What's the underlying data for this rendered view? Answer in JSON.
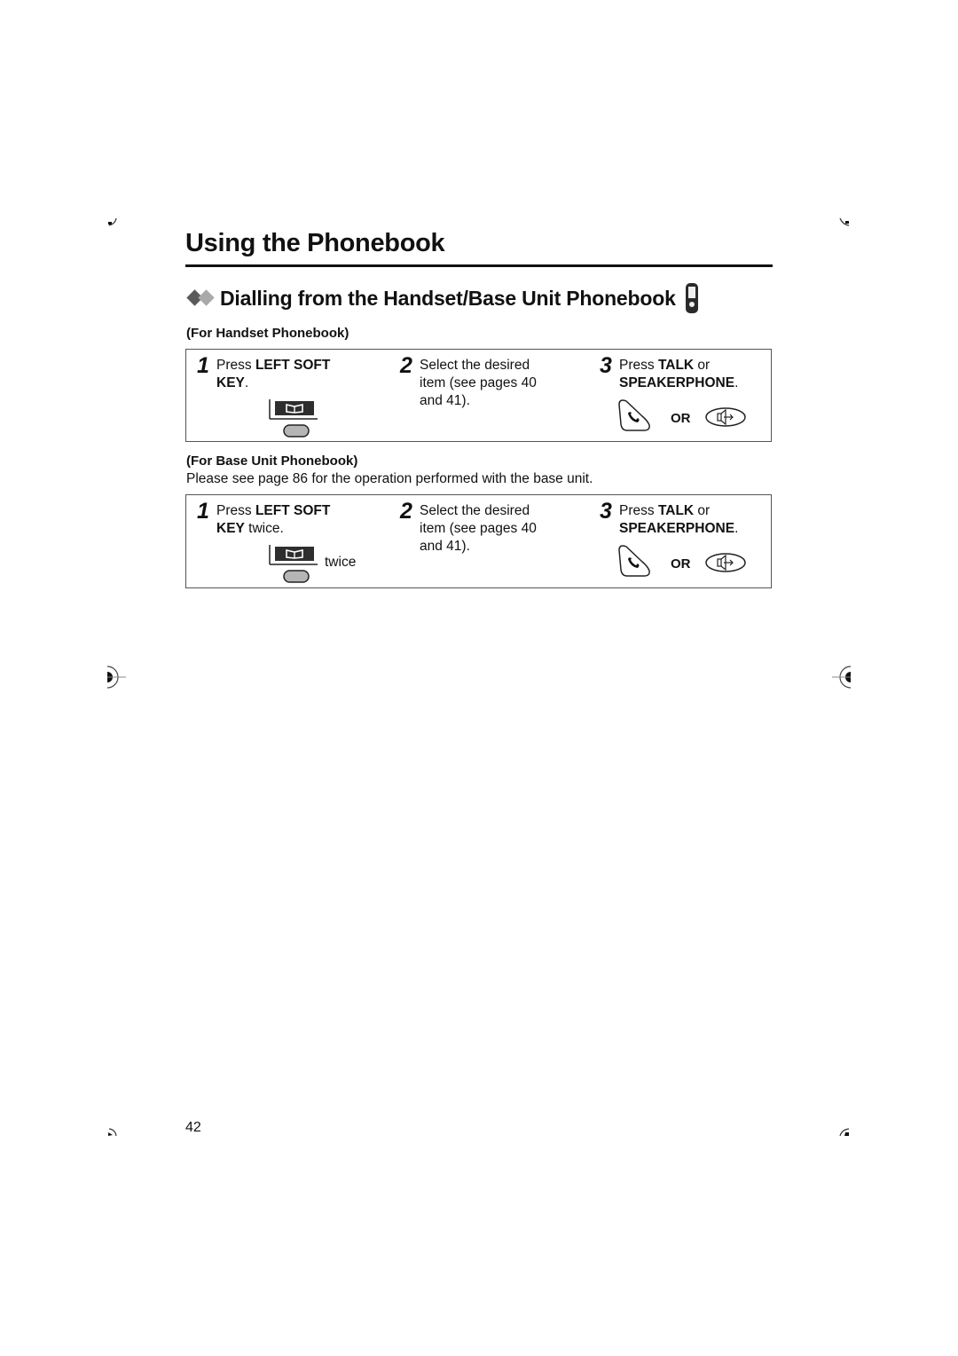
{
  "page": {
    "title": "Using the Phonebook",
    "section_heading": "Dialling from the Handset/Base Unit Phonebook",
    "page_number": "42"
  },
  "handset_section": {
    "heading": "(For Handset Phonebook)",
    "steps": [
      {
        "number": "1",
        "prefix": "Press ",
        "bold": "LEFT SOFT",
        "line2_bold": "KEY",
        "line2_rest": "."
      },
      {
        "number": "2",
        "lines": [
          "Select the desired",
          "item (see pages 40",
          "and 41)."
        ]
      },
      {
        "number": "3",
        "prefix": "Press ",
        "bold": "TALK",
        "suffix": " or",
        "line2_bold": "SPEAKERPHONE",
        "line2_rest": ".",
        "or_label": "OR"
      }
    ]
  },
  "base_section": {
    "heading": "(For Base Unit Phonebook)",
    "note": "Please see page 86 for the operation performed with the base unit.",
    "steps": [
      {
        "number": "1",
        "prefix": "Press ",
        "bold": "LEFT SOFT",
        "line2_bold": "KEY",
        "line2_rest": " twice.",
        "icon_caption": "twice"
      },
      {
        "number": "2",
        "lines": [
          "Select the desired",
          "item (see pages 40",
          "and 41)."
        ]
      },
      {
        "number": "3",
        "prefix": "Press ",
        "bold": "TALK",
        "suffix": " or",
        "line2_bold": "SPEAKERPHONE",
        "line2_rest": ".",
        "or_label": "OR"
      }
    ]
  },
  "icons": {
    "bullet": "double-diamond-icon",
    "handset": "handset-icon",
    "left_soft_key": "phonebook-soft-key-icon",
    "talk": "talk-button-icon",
    "speakerphone": "speakerphone-button-icon"
  },
  "colors": {
    "text": "#111111",
    "rule": "#111111",
    "box_border": "#555555",
    "diamond_dark": "#5a5a5a",
    "diamond_light": "#a9a9a9",
    "key_fill": "#b5b5b5"
  }
}
